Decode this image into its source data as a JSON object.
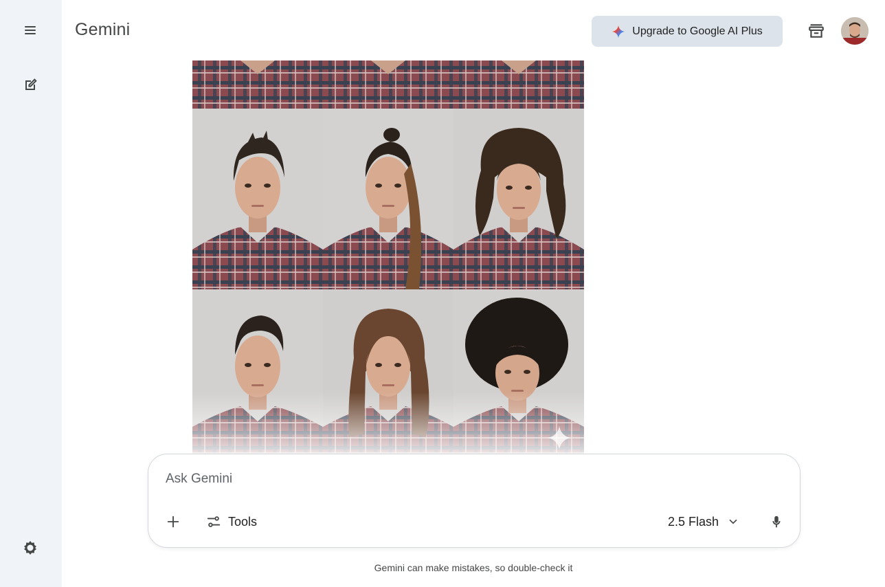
{
  "app": {
    "title": "Gemini"
  },
  "header": {
    "upgrade_label": "Upgrade to Google AI Plus",
    "upgrade_icon": "gemini-sparkle-icon"
  },
  "sidebar": {
    "icons": [
      "menu-icon",
      "new-chat-icon",
      "settings-icon"
    ]
  },
  "image_grid": {
    "cells": [
      {
        "hair": "top-cropped"
      },
      {
        "hair": "top-cropped"
      },
      {
        "hair": "top-cropped"
      },
      {
        "hair": "pompadour"
      },
      {
        "hair": "man-bun-ponytail"
      },
      {
        "hair": "long-wavy"
      },
      {
        "hair": "slicked-undercut"
      },
      {
        "hair": "long-flowing"
      },
      {
        "hair": "afro"
      }
    ]
  },
  "composer": {
    "placeholder": "Ask Gemini",
    "tools_label": "Tools",
    "model_label": "2.5 Flash"
  },
  "footer": {
    "disclaimer": "Gemini can make mistakes, so double-check it"
  },
  "colors": {
    "rail_bg": "#f0f4f9",
    "upgrade_bg": "#dde3ea",
    "text": "#1f1f1f"
  }
}
